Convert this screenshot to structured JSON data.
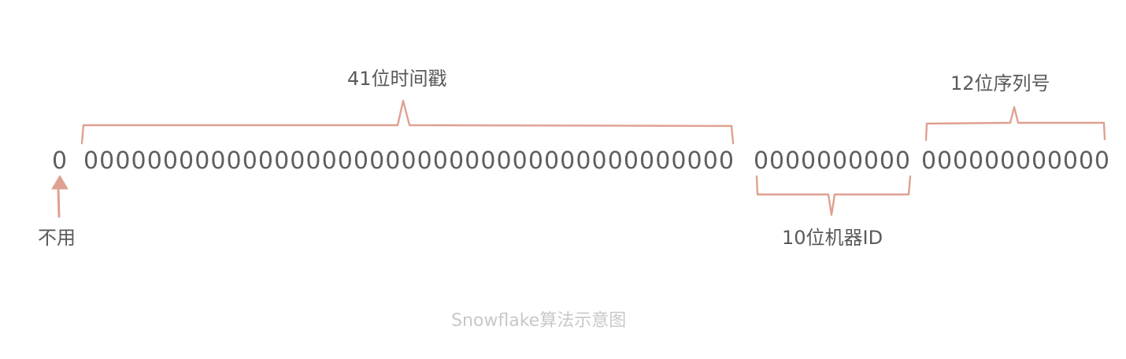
{
  "segments": {
    "sign_bit": {
      "bits": "0",
      "label": "不用"
    },
    "timestamp": {
      "bits": "00000000000000000000000000000000000000000",
      "label": "41位时间戳"
    },
    "machine_id": {
      "bits": "0000000000",
      "label": "10位机器ID"
    },
    "sequence": {
      "bits": "000000000000",
      "label": "12位序列号"
    }
  },
  "caption": "Snowflake算法示意图",
  "colors": {
    "bracket": "#dfa090",
    "digits": "#5f5f5f",
    "labels": "#595959",
    "caption": "#c8c8c8"
  }
}
